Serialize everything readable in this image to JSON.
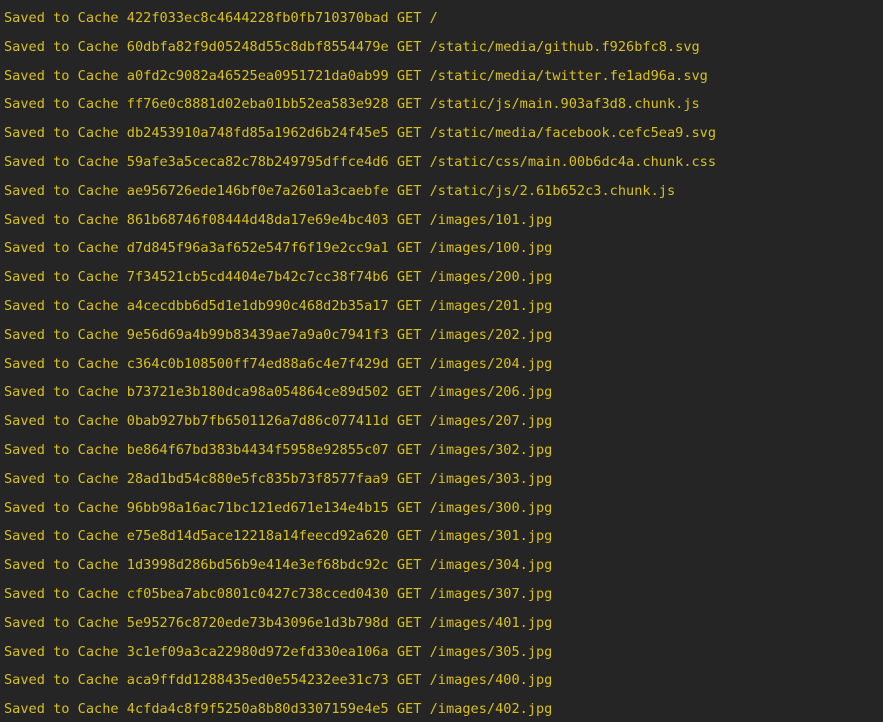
{
  "console": {
    "colors": {
      "background": "#252525",
      "text": "#d8c01f"
    },
    "lines": [
      {
        "status": "Saved to Cache",
        "hash": "422f033ec8c4644228fb0fb710370bad",
        "method": "GET",
        "path": "/"
      },
      {
        "status": "Saved to Cache",
        "hash": "60dbfa82f9d05248d55c8dbf8554479e",
        "method": "GET",
        "path": "/static/media/github.f926bfc8.svg"
      },
      {
        "status": "Saved to Cache",
        "hash": "a0fd2c9082a46525ea0951721da0ab99",
        "method": "GET",
        "path": "/static/media/twitter.fe1ad96a.svg"
      },
      {
        "status": "Saved to Cache",
        "hash": "ff76e0c8881d02eba01bb52ea583e928",
        "method": "GET",
        "path": "/static/js/main.903af3d8.chunk.js"
      },
      {
        "status": "Saved to Cache",
        "hash": "db2453910a748fd85a1962d6b24f45e5",
        "method": "GET",
        "path": "/static/media/facebook.cefc5ea9.svg"
      },
      {
        "status": "Saved to Cache",
        "hash": "59afe3a5ceca82c78b249795dffce4d6",
        "method": "GET",
        "path": "/static/css/main.00b6dc4a.chunk.css"
      },
      {
        "status": "Saved to Cache",
        "hash": "ae956726ede146bf0e7a2601a3caebfe",
        "method": "GET",
        "path": "/static/js/2.61b652c3.chunk.js"
      },
      {
        "status": "Saved to Cache",
        "hash": "861b68746f08444d48da17e69e4bc403",
        "method": "GET",
        "path": "/images/101.jpg"
      },
      {
        "status": "Saved to Cache",
        "hash": "d7d845f96a3af652e547f6f19e2cc9a1",
        "method": "GET",
        "path": "/images/100.jpg"
      },
      {
        "status": "Saved to Cache",
        "hash": "7f34521cb5cd4404e7b42c7cc38f74b6",
        "method": "GET",
        "path": "/images/200.jpg"
      },
      {
        "status": "Saved to Cache",
        "hash": "a4cecdbb6d5d1e1db990c468d2b35a17",
        "method": "GET",
        "path": "/images/201.jpg"
      },
      {
        "status": "Saved to Cache",
        "hash": "9e56d69a4b99b83439ae7a9a0c7941f3",
        "method": "GET",
        "path": "/images/202.jpg"
      },
      {
        "status": "Saved to Cache",
        "hash": "c364c0b108500ff74ed88a6c4e7f429d",
        "method": "GET",
        "path": "/images/204.jpg"
      },
      {
        "status": "Saved to Cache",
        "hash": "b73721e3b180dca98a054864ce89d502",
        "method": "GET",
        "path": "/images/206.jpg"
      },
      {
        "status": "Saved to Cache",
        "hash": "0bab927bb7fb6501126a7d86c077411d",
        "method": "GET",
        "path": "/images/207.jpg"
      },
      {
        "status": "Saved to Cache",
        "hash": "be864f67bd383b4434f5958e92855c07",
        "method": "GET",
        "path": "/images/302.jpg"
      },
      {
        "status": "Saved to Cache",
        "hash": "28ad1bd54c880e5fc835b73f8577faa9",
        "method": "GET",
        "path": "/images/303.jpg"
      },
      {
        "status": "Saved to Cache",
        "hash": "96bb98a16ac71bc121ed671e134e4b15",
        "method": "GET",
        "path": "/images/300.jpg"
      },
      {
        "status": "Saved to Cache",
        "hash": "e75e8d14d5ace12218a14feecd92a620",
        "method": "GET",
        "path": "/images/301.jpg"
      },
      {
        "status": "Saved to Cache",
        "hash": "1d3998d286bd56b9e414e3ef68bdc92c",
        "method": "GET",
        "path": "/images/304.jpg"
      },
      {
        "status": "Saved to Cache",
        "hash": "cf05bea7abc0801c0427c738cced0430",
        "method": "GET",
        "path": "/images/307.jpg"
      },
      {
        "status": "Saved to Cache",
        "hash": "5e95276c8720ede73b43096e1d3b798d",
        "method": "GET",
        "path": "/images/401.jpg"
      },
      {
        "status": "Saved to Cache",
        "hash": "3c1ef09a3ca22980d972efd330ea106a",
        "method": "GET",
        "path": "/images/305.jpg"
      },
      {
        "status": "Saved to Cache",
        "hash": "aca9ffdd1288435ed0e554232ee31c73",
        "method": "GET",
        "path": "/images/400.jpg"
      },
      {
        "status": "Saved to Cache",
        "hash": "4cfda4c8f9f5250a8b80d3307159e4e5",
        "method": "GET",
        "path": "/images/402.jpg"
      }
    ]
  }
}
